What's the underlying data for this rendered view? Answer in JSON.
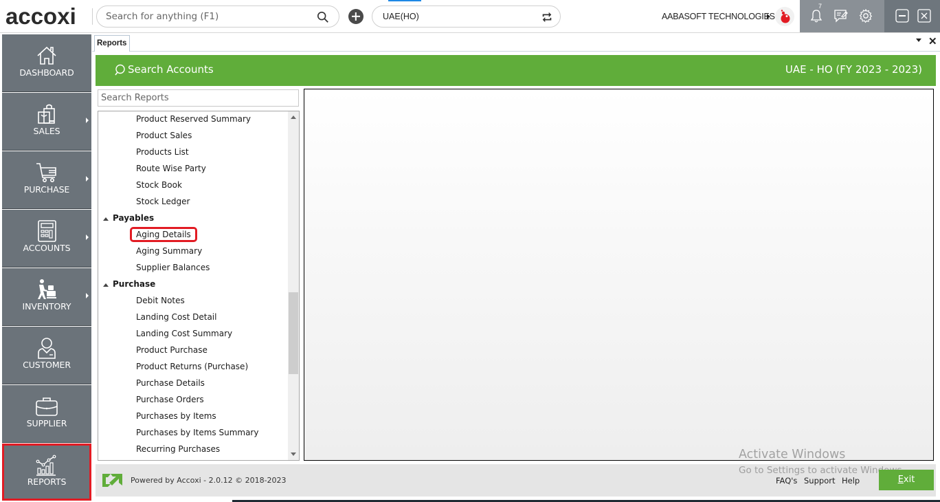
{
  "app": {
    "logo_text": "accoxi",
    "search_placeholder": "Search for anything (F1)",
    "company_selector_value": "UAE(HO)",
    "org_name": "AABASOFT TECHNOLOGIES",
    "notification_count": "7",
    "accent_green": "#60ad3a",
    "highlight_red": "#e21b23"
  },
  "sidebar": {
    "items": [
      {
        "label": "DASHBOARD",
        "icon": "home-icon",
        "has_submenu": false,
        "active": false
      },
      {
        "label": "SALES",
        "icon": "shopping-bags-icon",
        "has_submenu": true,
        "active": false
      },
      {
        "label": "PURCHASE",
        "icon": "cart-icon",
        "has_submenu": true,
        "active": false
      },
      {
        "label": "ACCOUNTS",
        "icon": "calculator-icon",
        "has_submenu": true,
        "active": false
      },
      {
        "label": "INVENTORY",
        "icon": "trolley-worker-icon",
        "has_submenu": true,
        "active": false
      },
      {
        "label": "CUSTOMER",
        "icon": "person-icon",
        "has_submenu": false,
        "active": false
      },
      {
        "label": "SUPPLIER",
        "icon": "briefcase-icon",
        "has_submenu": false,
        "active": false
      },
      {
        "label": "REPORTS",
        "icon": "chart-icon",
        "has_submenu": false,
        "active": true
      }
    ]
  },
  "tabs": [
    {
      "label": "Reports",
      "active": true
    }
  ],
  "header": {
    "search_accounts_label": "Search Accounts",
    "fiscal_label": "UAE - HO (FY 2023 - 2023)"
  },
  "reports": {
    "search_placeholder": "Search Reports",
    "tree": [
      {
        "type": "item",
        "label": "Product Reserved Summary"
      },
      {
        "type": "item",
        "label": "Product Sales"
      },
      {
        "type": "item",
        "label": "Products List"
      },
      {
        "type": "item",
        "label": "Route Wise Party"
      },
      {
        "type": "item",
        "label": "Stock Book"
      },
      {
        "type": "item",
        "label": "Stock Ledger"
      },
      {
        "type": "group",
        "label": "Payables",
        "expanded": true
      },
      {
        "type": "item",
        "label": "Aging Details",
        "highlighted": true
      },
      {
        "type": "item",
        "label": "Aging Summary"
      },
      {
        "type": "item",
        "label": "Supplier Balances"
      },
      {
        "type": "group",
        "label": "Purchase",
        "expanded": true
      },
      {
        "type": "item",
        "label": "Debit Notes"
      },
      {
        "type": "item",
        "label": "Landing Cost Detail"
      },
      {
        "type": "item",
        "label": "Landing Cost Summary"
      },
      {
        "type": "item",
        "label": "Product Purchase"
      },
      {
        "type": "item",
        "label": "Product Returns (Purchase)"
      },
      {
        "type": "item",
        "label": "Purchase Details"
      },
      {
        "type": "item",
        "label": "Purchase Orders"
      },
      {
        "type": "item",
        "label": "Purchases by Items"
      },
      {
        "type": "item",
        "label": "Purchases by Items Summary"
      },
      {
        "type": "item",
        "label": "Recurring Purchases"
      }
    ],
    "scroll_position_fraction": 0.52,
    "scroll_visible_fraction": 0.25
  },
  "footer": {
    "powered_by": "Powered by Accoxi - 2.0.12 © 2018-2023",
    "links": [
      "FAQ's",
      "Support",
      "Help"
    ],
    "exit_label_underlined": "E",
    "exit_label_rest": "xit"
  },
  "os_watermark": {
    "line1": "Activate Windows",
    "line2": "Go to Settings to activate Windows."
  }
}
